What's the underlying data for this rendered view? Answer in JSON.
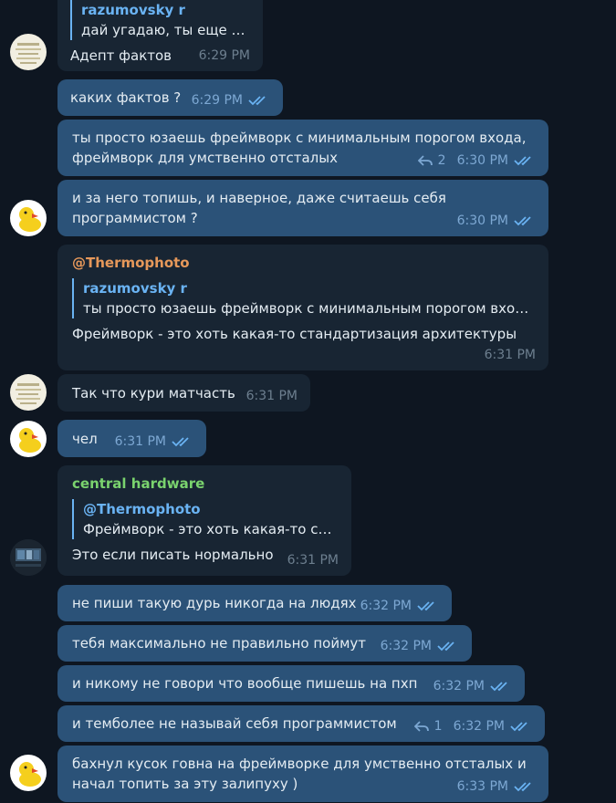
{
  "theme": {
    "bg": "#0e1621",
    "incoming": "#182533",
    "outgoing": "#2b5278",
    "link": "#6ab3f3",
    "sender_orange": "#e6985a",
    "sender_green": "#7ad36e"
  },
  "messages": {
    "m1": {
      "reply_name": "razumovsky r",
      "reply_text": "дай угадаю, ты еще а...",
      "text": "Адепт фактов",
      "time": "6:29 PM"
    },
    "m2": {
      "text": "каких фактов ?",
      "time": "6:29 PM"
    },
    "m3": {
      "text": "ты просто юзаешь фреймворк с минимальным порогом входа,\nфреймворк для умственно отсталых",
      "replies": "2",
      "time": "6:30 PM"
    },
    "m4": {
      "text": "и за него топишь, и наверное, даже считаешь себя\nпрограммистом ?",
      "time": "6:30 PM"
    },
    "m5": {
      "sender": "@Thermophoto",
      "reply_name": "razumovsky r",
      "reply_text": "ты просто юзаешь фреймворк с минимальным порогом вход...",
      "text": "Фреймворк - это хоть какая-то стандартизация архитектуры",
      "time": "6:31 PM"
    },
    "m6": {
      "text": "Так что кури матчасть",
      "time": "6:31 PM"
    },
    "m7": {
      "text": "чел",
      "time": "6:31 PM"
    },
    "m8": {
      "sender": "central hardware",
      "reply_name": "@Thermophoto",
      "reply_text": "Фреймворк - это хоть какая-то ста...",
      "text": "Это если писать нормально",
      "time": "6:31 PM"
    },
    "m9": {
      "text": "не пиши такую дурь никогда на людях",
      "time": "6:32 PM"
    },
    "m10": {
      "text": "тебя максимально не правильно поймут",
      "time": "6:32 PM"
    },
    "m11": {
      "text": "и никому не говори что вообще пишешь на пхп",
      "time": "6:32 PM"
    },
    "m12": {
      "text": "и темболее не называй себя программистом",
      "replies": "1",
      "time": "6:32 PM"
    },
    "m13": {
      "text": "бахнул кусок говна на фреймворке для умственно отсталых и\nначал топить за эту залипуху )",
      "time": "6:33 PM"
    }
  }
}
